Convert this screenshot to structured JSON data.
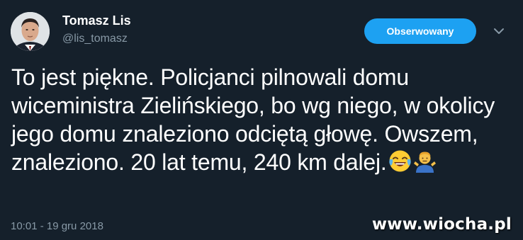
{
  "tweet": {
    "author": {
      "display_name": "Tomasz Lis",
      "handle": "@lis_tomasz"
    },
    "follow_button_label": "Obserwowany",
    "text": "To jest piękne. Policjanci pilnowali domu wiceministra Zielińskiego, bo wg niego, w okolicy jego domu znaleziono odciętą głowę. Owszem, znaleziono. 20 lat temu, 240 km dalej.",
    "emojis": [
      "face-with-tears-of-joy",
      "person-shrugging"
    ],
    "timestamp": "10:01 - 19 gru 2018"
  },
  "watermark": {
    "text": "www.wiocha.pl"
  },
  "colors": {
    "background": "#15202b",
    "accent": "#1da1f2",
    "secondary_text": "#8899a6",
    "primary_text": "#ffffff"
  }
}
